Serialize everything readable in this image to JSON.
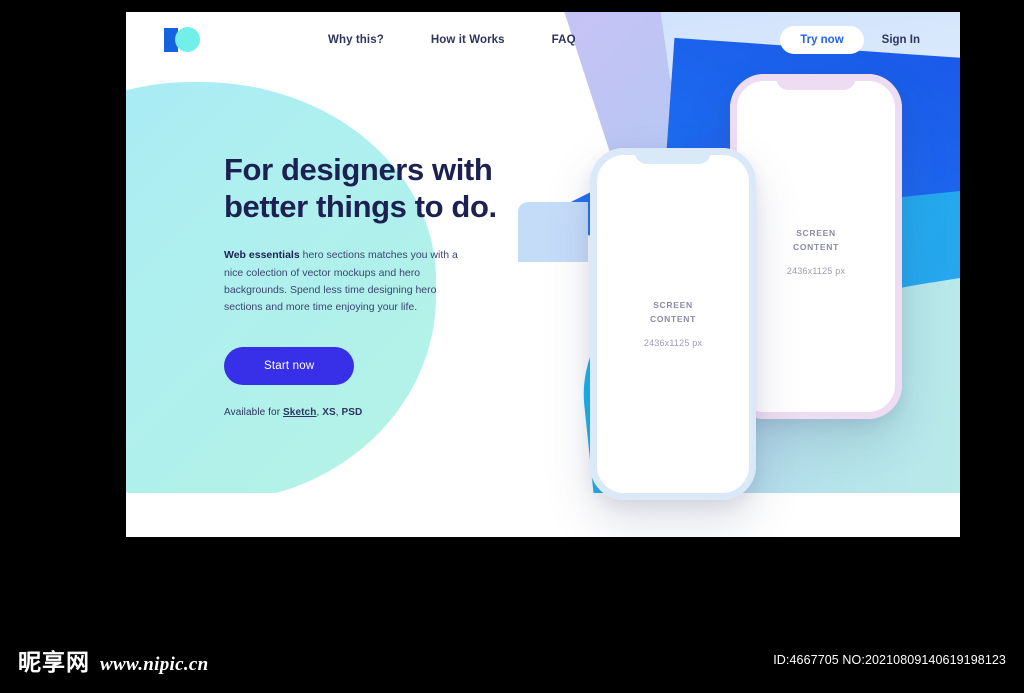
{
  "page": {
    "title": "Web essentials hero section landing page"
  },
  "nav": {
    "logo_name": "brand-logo",
    "links": [
      {
        "label": "Why this?"
      },
      {
        "label": "How it Works"
      },
      {
        "label": "FAQ"
      }
    ],
    "try_now_label": "Try now",
    "sign_in_label": "Sign In"
  },
  "hero": {
    "title_line1": "For designers with",
    "title_line2": "better things to do.",
    "desc_bold": "Web essentials",
    "desc_rest": " hero sections matches you with a nice colection of vector mockups and hero backgrounds. Spend less time designing hero sections and more time enjoying your life.",
    "cta_label": "Start now",
    "available_prefix": "Available for ",
    "available_sketch": "Sketch",
    "available_sep1": ", ",
    "available_xs": "XS",
    "available_sep2": ", ",
    "available_psd": "PSD"
  },
  "mockups": {
    "back_phone": {
      "screen_line1": "SCREEN",
      "screen_line2": "CONTENT",
      "dimensions": "2436x1125 px"
    },
    "front_phone": {
      "screen_line1": "SCREEN",
      "screen_line2": "CONTENT",
      "dimensions": "2436x1125 px"
    }
  },
  "footer": {
    "watermark_cn": "昵享网",
    "watermark_url": "www.nipic.cn",
    "id_text": "ID:4667705 NO:20210809140619198123"
  },
  "colors": {
    "brand_blue": "#1663e0",
    "brand_cyan": "#72efe8",
    "cta_indigo": "#3730e8",
    "text_navy": "#1c2152",
    "nav_text": "#2f3461",
    "screen_gray": "#8b8ba8"
  }
}
